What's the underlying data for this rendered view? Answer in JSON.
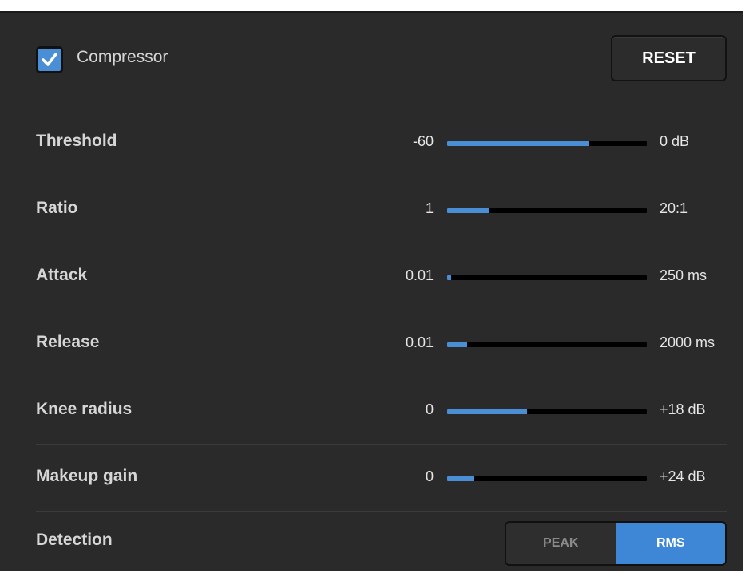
{
  "header": {
    "compressor_label": "Compressor",
    "compressor_enabled": true,
    "reset_label": "RESET"
  },
  "colors": {
    "accent": "#4a8fd6",
    "panel_bg": "#2a2a2a",
    "track_bg": "#000000"
  },
  "sliders": [
    {
      "label": "Threshold",
      "min": "-60",
      "max": "0 dB",
      "fill_fraction": 0.71
    },
    {
      "label": "Ratio",
      "min": "1",
      "max": "20:1",
      "fill_fraction": 0.21
    },
    {
      "label": "Attack",
      "min": "0.01",
      "max": "250 ms",
      "fill_fraction": 0.02
    },
    {
      "label": "Release",
      "min": "0.01",
      "max": "2000 ms",
      "fill_fraction": 0.1
    },
    {
      "label": "Knee radius",
      "min": "0",
      "max": "+18 dB",
      "fill_fraction": 0.4
    },
    {
      "label": "Makeup gain",
      "min": "0",
      "max": "+24 dB",
      "fill_fraction": 0.13
    }
  ],
  "detection": {
    "label": "Detection",
    "options": [
      "PEAK",
      "RMS"
    ],
    "selected": "RMS"
  }
}
